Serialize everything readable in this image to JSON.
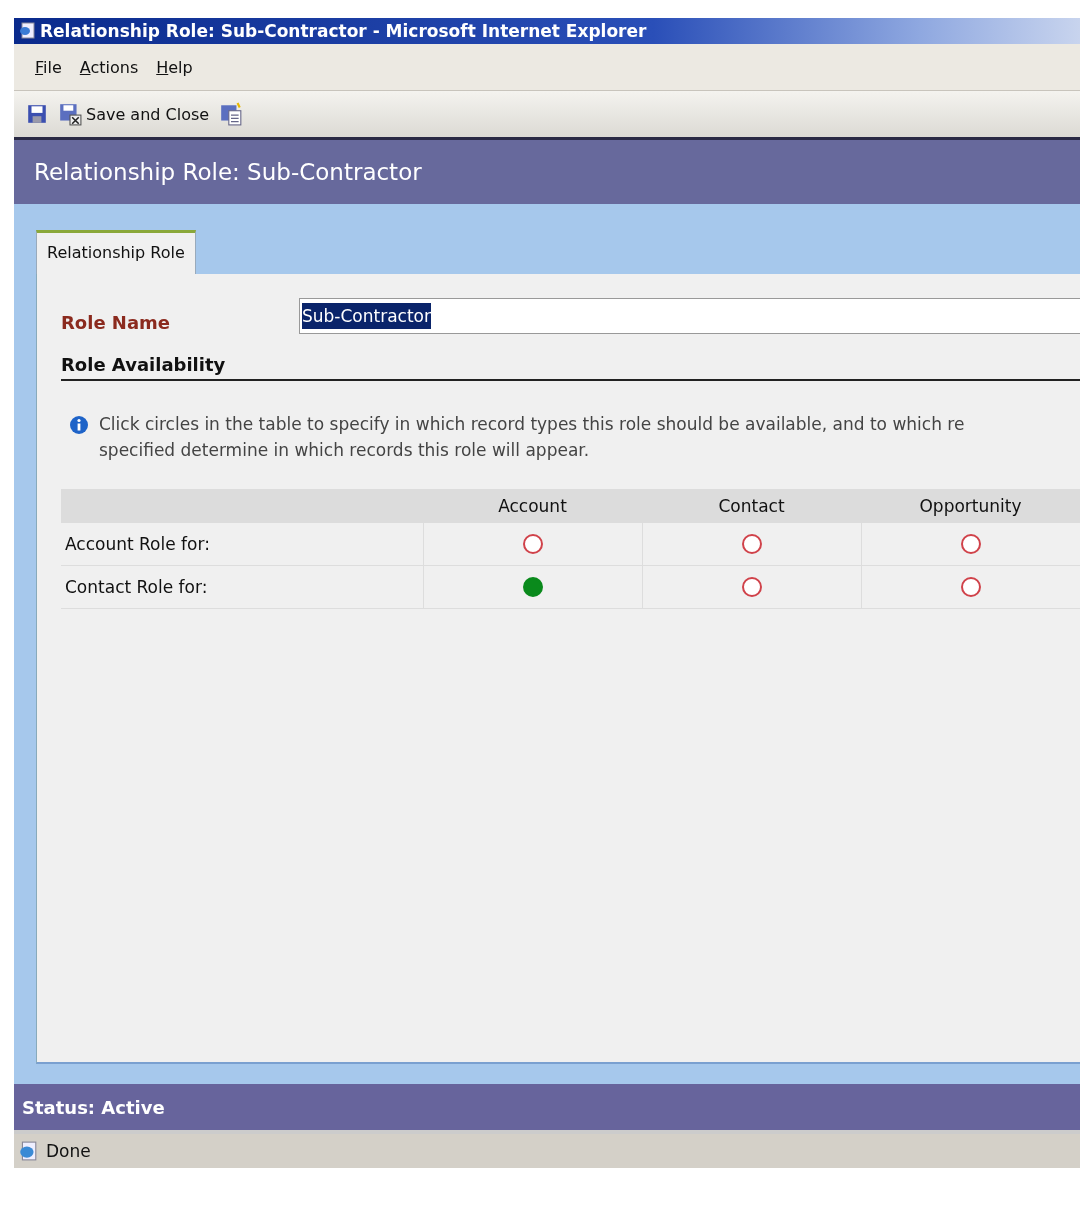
{
  "window": {
    "title": "Relationship Role: Sub-Contractor - Microsoft Internet Explorer"
  },
  "menu": [
    "File",
    "Actions",
    "Help"
  ],
  "toolbar": {
    "save_and_close": "Save and Close"
  },
  "header": {
    "title": "Relationship Role: Sub-Contractor"
  },
  "tabs": [
    {
      "label": "Relationship Role",
      "selected": true
    }
  ],
  "form": {
    "role_name_label": "Role Name",
    "role_name_value": "Sub-Contractor",
    "section_title": "Role Availability",
    "info_text": "Click circles in the table to specify in which record types this role should be available, and to which re",
    "info_text_2": "specified determine in which records this role will appear."
  },
  "table": {
    "columns": [
      "Account",
      "Contact",
      "Opportunity"
    ],
    "rows": [
      {
        "label": "Account Role for:",
        "cells": [
          {
            "selected": false
          },
          {
            "selected": false
          },
          {
            "selected": false
          }
        ]
      },
      {
        "label": "Contact Role for:",
        "cells": [
          {
            "selected": true
          },
          {
            "selected": false
          },
          {
            "selected": false
          }
        ]
      }
    ]
  },
  "status": "Status: Active",
  "status_bar": "Done"
}
